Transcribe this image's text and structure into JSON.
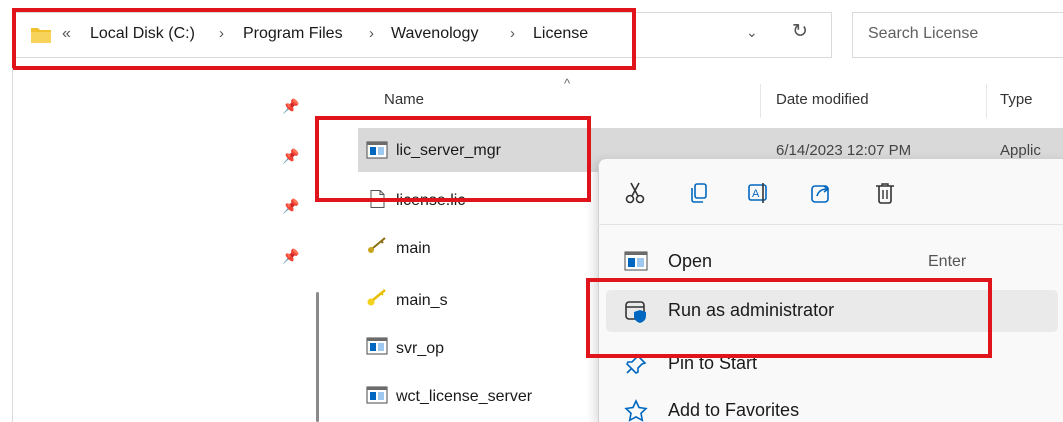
{
  "breadcrumb": {
    "overflow": "«",
    "items": [
      "Local Disk (C:)",
      "Program Files",
      "Wavenology",
      "License"
    ],
    "separator": "›"
  },
  "search": {
    "placeholder": "Search License"
  },
  "columns": {
    "name": "Name",
    "date": "Date modified",
    "type": "Type"
  },
  "files": [
    {
      "name": "lic_server_mgr",
      "icon": "application-icon",
      "date": "6/14/2023 12:07 PM",
      "type": "Applic"
    },
    {
      "name": "license.lic",
      "icon": "document-icon"
    },
    {
      "name": "main",
      "icon": "key-icon"
    },
    {
      "name": "main_s",
      "icon": "key-icon"
    },
    {
      "name": "svr_op",
      "icon": "application-icon"
    },
    {
      "name": "wct_license_server",
      "icon": "application-icon"
    }
  ],
  "context_menu": {
    "top_actions": [
      "cut-icon",
      "copy-icon",
      "rename-icon",
      "share-icon",
      "delete-icon"
    ],
    "items": [
      {
        "label": "Open",
        "shortcut": "Enter",
        "icon": "open-icon"
      },
      {
        "label": "Run as administrator",
        "icon": "shield-icon"
      },
      {
        "label": "Pin to Start",
        "icon": "pin-icon"
      },
      {
        "label": "Add to Favorites",
        "icon": "star-icon"
      }
    ]
  },
  "colors": {
    "highlight": "#e0141b",
    "selection": "#d9d9d9",
    "accent": "#0067c0",
    "folder": "#f2c12e"
  }
}
